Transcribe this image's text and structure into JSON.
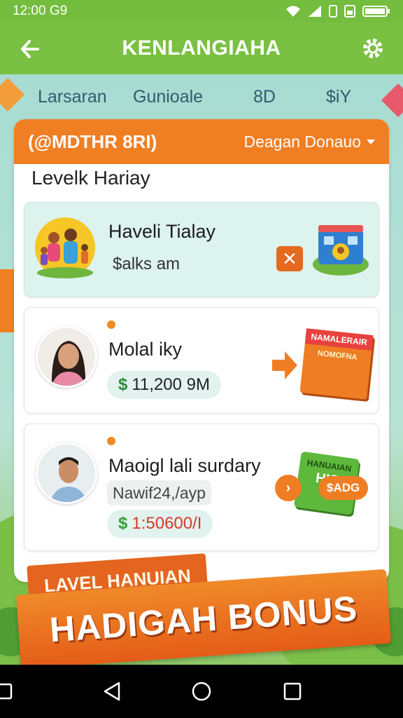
{
  "status_bar": {
    "time": "12:00 G9"
  },
  "app_bar": {
    "title": "KENLANGIAHA"
  },
  "tabs": [
    {
      "label": "Larsaran"
    },
    {
      "label": "Gunioale"
    },
    {
      "label": "8D"
    },
    {
      "label": "$iY"
    }
  ],
  "card": {
    "header_left": "(@MDTHR 8RI)",
    "header_dropdown": "Deagan Donauo",
    "section_title": "Levelk Hariay",
    "items": [
      {
        "name": "Haveli Tialay",
        "subtitle": "$alks am"
      },
      {
        "name": "Molal iky",
        "amount": "11,200 9M",
        "amount_prefix": "$"
      },
      {
        "name": "Maoigl lali surdary",
        "meta": "Nawif24,/ayp",
        "amount": "1:50600/I",
        "amount_prefix": "$"
      }
    ],
    "item_graphics": {
      "book_text_1": "NAMALERAIR",
      "book_text_2": "NOMOFNA",
      "ticket_text": "HANUAIAN",
      "ticket_text_2": "HIS",
      "ticket_badge": "$ADG"
    }
  },
  "banner": {
    "small": "LAVEL HANUIAN",
    "big": "HADIGAH BONUS"
  },
  "colors": {
    "primary_green": "#79c043",
    "accent_orange": "#f07f24",
    "highlight_teal": "#dcf3ee"
  }
}
